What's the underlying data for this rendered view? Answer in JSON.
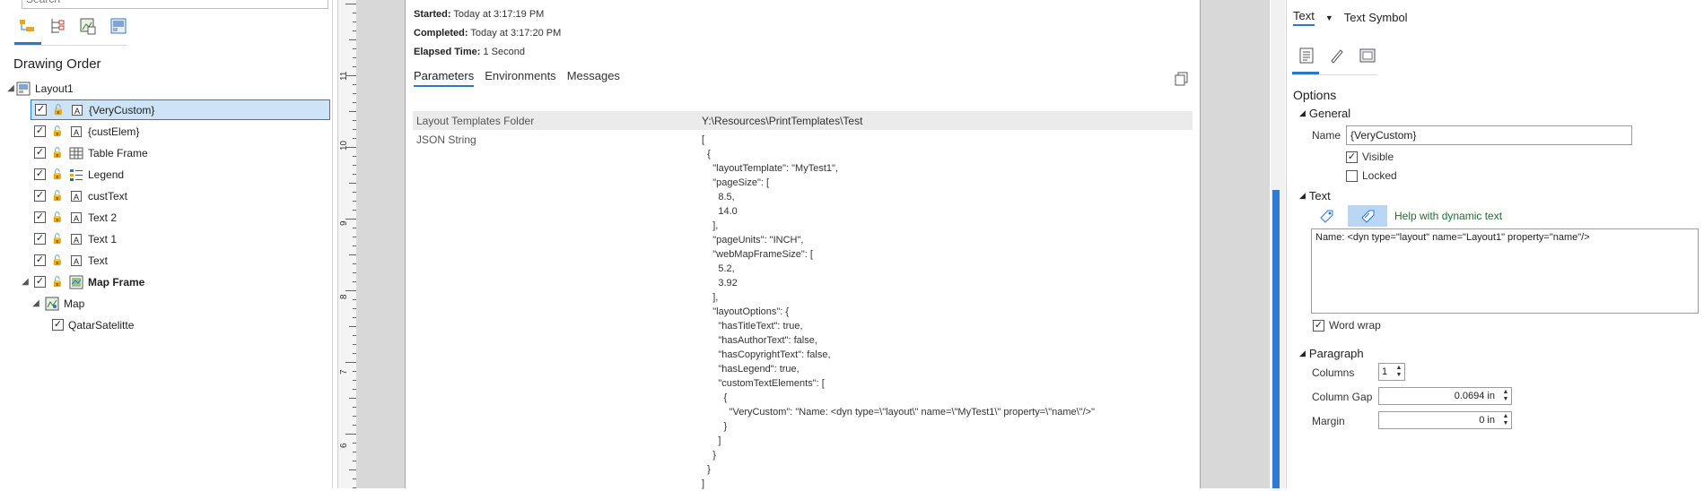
{
  "contents": {
    "search_placeholder": "Search",
    "heading": "Drawing Order",
    "root": "Layout1",
    "items": [
      {
        "label": "{VeryCustom}",
        "checked": true
      },
      {
        "label": "{custElem}",
        "checked": true
      },
      {
        "label": "Table Frame",
        "checked": true
      },
      {
        "label": "Legend",
        "checked": true
      },
      {
        "label": "custText",
        "checked": true
      },
      {
        "label": "Text 2",
        "checked": true
      },
      {
        "label": "Text 1",
        "checked": true
      },
      {
        "label": "Text",
        "checked": true
      },
      {
        "label": "Map Frame",
        "checked": true
      }
    ],
    "map": "Map",
    "layer": "QatarSatelitte"
  },
  "ruler_labels": [
    "11",
    "10",
    "9",
    "8",
    "7",
    "6"
  ],
  "details": {
    "started_label": "Started:",
    "started_value": "Today at 3:17:19 PM",
    "completed_label": "Completed:",
    "completed_value": "Today at 3:17:20 PM",
    "elapsed_label": "Elapsed Time:",
    "elapsed_value": "1 Second",
    "tabs": [
      "Parameters",
      "Environments",
      "Messages"
    ],
    "params": [
      {
        "name": "Layout Templates Folder",
        "value": "Y:\\Resources\\PrintTemplates\\Test"
      },
      {
        "name": "JSON String",
        "value": ""
      }
    ],
    "json_text": "[\n  {\n    \"layoutTemplate\": \"MyTest1\",\n    \"pageSize\": [\n      8.5,\n      14.0\n    ],\n    \"pageUnits\": \"INCH\",\n    \"webMapFrameSize\": [\n      5.2,\n      3.92\n    ],\n    \"layoutOptions\": {\n      \"hasTitleText\": true,\n      \"hasAuthorText\": false,\n      \"hasCopyrightText\": false,\n      \"hasLegend\": true,\n      \"customTextElements\": [\n        {\n          \"VeryCustom\": \"Name: <dyn type=\\\"layout\\\" name=\\\"MyTest1\\\" property=\\\"name\\\"/>\"\n        }\n      ]\n    }\n  }\n]"
  },
  "format": {
    "tab_text": "Text",
    "tab_symbol": "Text Symbol",
    "options": "Options",
    "general": "General",
    "name_label": "Name",
    "name_value": "{VeryCustom}",
    "visible_label": "Visible",
    "visible_checked": true,
    "locked_label": "Locked",
    "locked_checked": false,
    "text_section": "Text",
    "help_dynamic": "Help with dynamic text",
    "text_value": "Name: <dyn type=\"layout\" name=\"Layout1\" property=\"name\"/>",
    "word_wrap_label": "Word wrap",
    "word_wrap_checked": true,
    "paragraph": "Paragraph",
    "columns_label": "Columns",
    "columns_value": "1",
    "column_gap_label": "Column Gap",
    "column_gap_value": "0.0694 in",
    "margin_label": "Margin",
    "margin_value": "0 in"
  },
  "colors": {
    "accent": "#2b78c5",
    "selection": "#cde3f7",
    "link_green": "#1e6f32"
  }
}
